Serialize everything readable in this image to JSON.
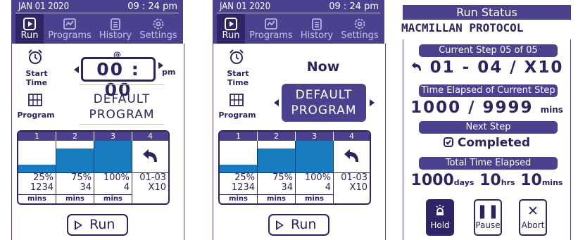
{
  "screen1": {
    "header": {
      "date": "JAN 01 2020",
      "time": "09 : 24 pm"
    },
    "tabs": [
      {
        "label": "Run",
        "icon": "play-square-icon"
      },
      {
        "label": "Programs",
        "icon": "programs-icon"
      },
      {
        "label": "History",
        "icon": "clipboard-icon"
      },
      {
        "label": "Settings",
        "icon": "gear-icon"
      }
    ],
    "start_time_label": "Start Time",
    "at_symbol": "@",
    "start_time_value": "00 : 00",
    "ampm": "pm",
    "program_label": "Program",
    "program_line1": "DEFAULT",
    "program_line2": "PROGRAM",
    "run_label": "Run"
  },
  "screen2": {
    "header": {
      "date": "JAN 01 2020",
      "time": "09 : 24 pm"
    },
    "tabs": [
      {
        "label": "Run"
      },
      {
        "label": "Programs"
      },
      {
        "label": "History"
      },
      {
        "label": "Settings"
      }
    ],
    "start_time_label": "Start Time",
    "start_time_value": "Now",
    "program_label": "Program",
    "program_line1": "DEFAULT",
    "program_line2": "PROGRAM",
    "run_label": "Run"
  },
  "steps": [
    {
      "num": "1",
      "fill": 0.25,
      "pct": "25%",
      "time": "1234",
      "unit": "mins"
    },
    {
      "num": "2",
      "fill": 0.75,
      "pct": "75%",
      "time": "34",
      "unit": "mins"
    },
    {
      "num": "3",
      "fill": 1.0,
      "pct": "100%",
      "time": "4",
      "unit": "mins"
    },
    {
      "num": "4",
      "fill": 0,
      "pct": "01-03",
      "time": "X10",
      "unit": "",
      "icon": "loop-back-icon"
    }
  ],
  "run_status": {
    "title": "Run Status",
    "protocol": "MACMILLAN PROTOCOL",
    "current_step_label": "Current Step 05 of 05",
    "current_step_value": "01 - 04 / X10",
    "time_elapsed_label": "Time Elapsed of Current Step",
    "time_elapsed_value": "1000 / 9999",
    "time_elapsed_unit": "mins",
    "next_step_label": "Next Step",
    "next_step_value": "Completed",
    "total_label": "Total Time Elapsed",
    "total_days": "1000",
    "days_unit": "days",
    "total_hrs": "10",
    "hrs_unit": "hrs",
    "total_mins": "10",
    "mins_unit": "mins",
    "buttons": [
      {
        "label": "Hold"
      },
      {
        "label": "Pause"
      },
      {
        "label": "Abort"
      }
    ]
  },
  "colors": {
    "primary": "#4a418f",
    "dark": "#2e2566",
    "fill": "#1a7cc0"
  }
}
